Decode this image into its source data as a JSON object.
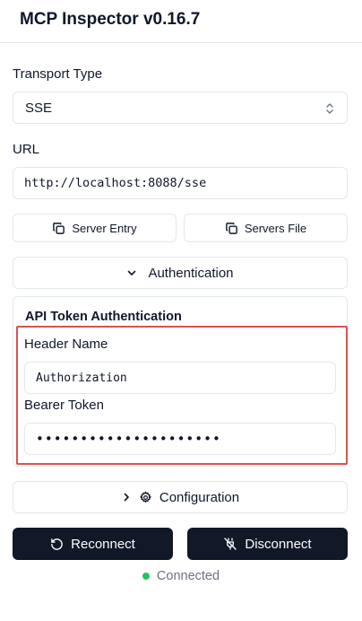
{
  "app": {
    "title": "MCP Inspector v0.16.7"
  },
  "transport": {
    "label": "Transport Type",
    "selected": "SSE"
  },
  "url": {
    "label": "URL",
    "value": "http://localhost:8088/sse"
  },
  "config_buttons": {
    "server_entry": "Server Entry",
    "servers_file": "Servers File"
  },
  "authentication": {
    "toggle_label": "Authentication",
    "expanded": true,
    "panel_title": "API Token Authentication",
    "header_name_label": "Header Name",
    "header_name_value": "Authorization",
    "bearer_token_label": "Bearer Token",
    "bearer_token_masked": "•••••••••••••••••••••"
  },
  "configuration": {
    "toggle_label": "Configuration"
  },
  "actions": {
    "reconnect": "Reconnect",
    "disconnect": "Disconnect"
  },
  "status": {
    "text": "Connected",
    "color": "#22c55e"
  },
  "colors": {
    "accent_dark": "#111827",
    "highlight": "#d9534f",
    "border": "#e2e8f0"
  }
}
